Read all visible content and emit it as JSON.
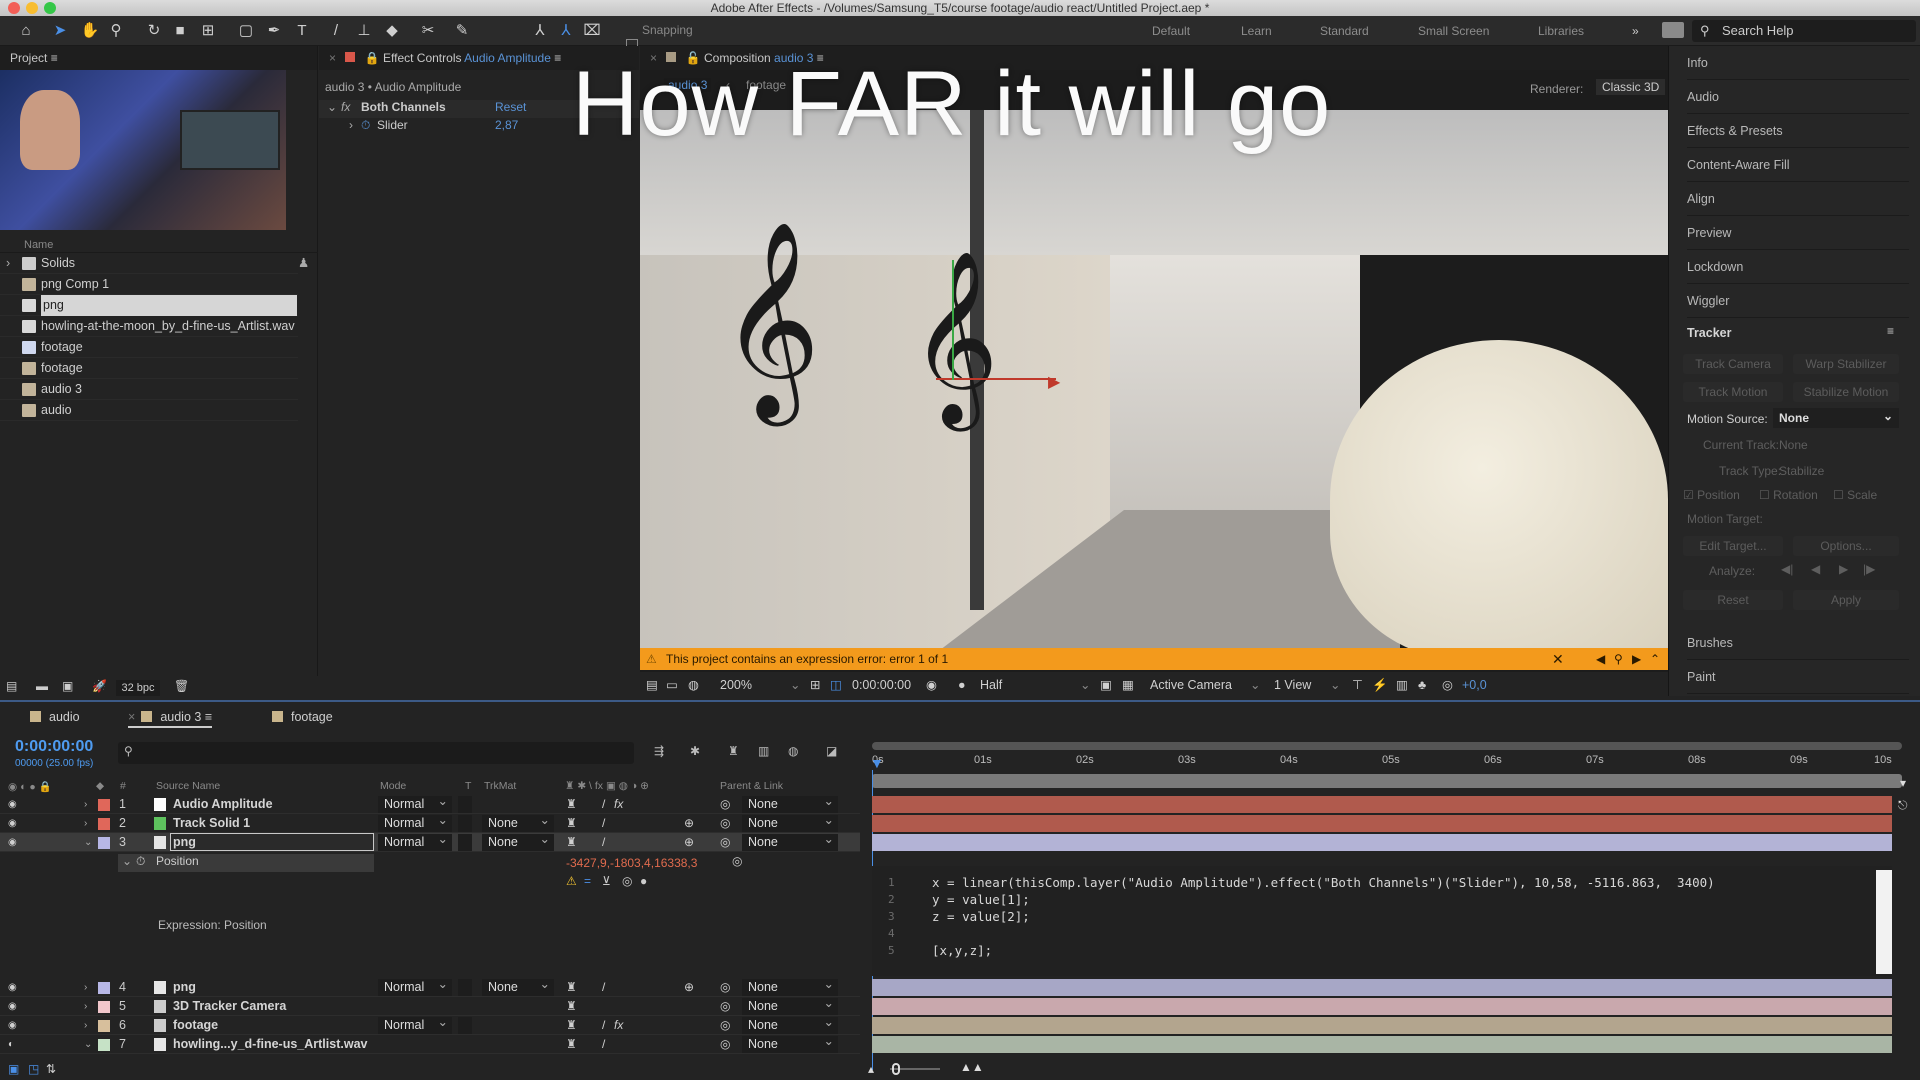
{
  "window": {
    "title": "Adobe After Effects - /Volumes/Samsung_T5/course footage/audio react/Untitled Project.aep *"
  },
  "toolbar": {
    "tools": [
      "home-icon",
      "selection-tool-icon",
      "hand-tool-icon",
      "zoom-tool-icon",
      "rotate-tool-icon",
      "camera-tool-icon",
      "pan-behind-icon",
      "rectangle-tool-icon",
      "pen-tool-icon",
      "type-tool-icon",
      "brush-tool-icon",
      "clone-stamp-icon",
      "eraser-icon",
      "roto-brush-icon",
      "puppet-pin-icon",
      "axis-local-icon",
      "axis-world-icon",
      "axis-view-icon"
    ],
    "snapping_label": "Snapping",
    "workspaces": [
      "Default",
      "Learn",
      "Standard",
      "Small Screen",
      "Libraries"
    ],
    "more": "»",
    "search_placeholder": "Search Help"
  },
  "project": {
    "tab_label": "Project",
    "name_header": "Name",
    "items": [
      {
        "name": "Solids",
        "type": "folder"
      },
      {
        "name": "png Comp 1",
        "type": "comp"
      },
      {
        "name": "png",
        "type": "file",
        "selected": true
      },
      {
        "name": "howling-at-the-moon_by_d-fine-us_Artlist.wav",
        "type": "audio"
      },
      {
        "name": "footage",
        "type": "video"
      },
      {
        "name": "footage",
        "type": "comp"
      },
      {
        "name": "audio 3",
        "type": "comp"
      },
      {
        "name": "audio",
        "type": "comp"
      }
    ],
    "bpc": "32 bpc"
  },
  "effect_controls": {
    "tab_prefix": "Effect Controls",
    "tab_layer": "Audio Amplitude",
    "breadcrumb": "audio 3 • Audio Amplitude",
    "effect_name": "Both Channels",
    "reset_label": "Reset",
    "property": "Slider",
    "property_value": "2,87"
  },
  "composition": {
    "tab_prefix": "Composition",
    "tab_name": "audio 3",
    "flow": [
      "audio 3",
      "footage"
    ],
    "renderer_label": "Renderer:",
    "renderer_value": "Classic 3D",
    "overlay_title": "How FAR it will go",
    "error_message": "This project contains an expression error: error 1 of 1",
    "viewbar": {
      "zoom": "200%",
      "timecode": "0:00:00:00",
      "resolution": "Half",
      "camera": "Active Camera",
      "views": "1 View",
      "exposure": "+0,0"
    }
  },
  "right_panel": {
    "items": [
      "Info",
      "Audio",
      "Effects & Presets",
      "Content-Aware Fill",
      "Align",
      "Preview",
      "Lockdown",
      "Wiggler"
    ],
    "tracker": {
      "title": "Tracker",
      "buttons": [
        "Track Camera",
        "Warp Stabilizer",
        "Track Motion",
        "Stabilize Motion"
      ],
      "motion_source_label": "Motion Source:",
      "motion_source_value": "None",
      "current_track_label": "Current Track:",
      "current_track_value": "None",
      "track_type_label": "Track Type:",
      "track_type_value": "Stabilize",
      "checks": [
        {
          "label": "Position",
          "checked": true
        },
        {
          "label": "Rotation",
          "checked": false
        },
        {
          "label": "Scale",
          "checked": false
        }
      ],
      "motion_target_label": "Motion Target:",
      "edit_target": "Edit Target...",
      "options": "Options...",
      "analyze_label": "Analyze:",
      "reset": "Reset",
      "apply": "Apply"
    },
    "bottom_items": [
      "Brushes",
      "Paint"
    ]
  },
  "timeline": {
    "tabs": [
      {
        "label": "audio",
        "color": "#c9b58c"
      },
      {
        "label": "audio 3",
        "color": "#c9b58c",
        "active": true
      },
      {
        "label": "footage",
        "color": "#c9b58c"
      }
    ],
    "timecode": "0:00:00:00",
    "fps": "00000 (25.00 fps)",
    "columns": {
      "num": "#",
      "source": "Source Name",
      "mode": "Mode",
      "t": "T",
      "trkmat": "TrkMat",
      "parent": "Parent & Link"
    },
    "layers": [
      {
        "num": "1",
        "name": "Audio Amplitude",
        "label_color": "#e0675a",
        "icon_color": "#ffffff",
        "mode": "Normal",
        "trkmat": "",
        "parent": "None",
        "fx": true,
        "bar": "#b05a4d"
      },
      {
        "num": "2",
        "name": "Track Solid 1",
        "label_color": "#e0675a",
        "icon_color": "#5ec25e",
        "mode": "Normal",
        "trkmat": "None",
        "parent": "None",
        "fx": false,
        "bar": "#b05a4d"
      },
      {
        "num": "3",
        "name": "png",
        "label_color": "#b7b7e6",
        "icon_color": "#e6e6e6",
        "mode": "Normal",
        "trkmat": "None",
        "parent": "None",
        "fx": false,
        "bar": "#b3b3d6",
        "selected": true
      },
      {
        "num": "4",
        "name": "png",
        "label_color": "#b7b7e6",
        "icon_color": "#e6e6e6",
        "mode": "Normal",
        "trkmat": "None",
        "parent": "None",
        "fx": false,
        "bar": "#a7a7c6"
      },
      {
        "num": "5",
        "name": "3D Tracker Camera",
        "label_color": "#f1c6cb",
        "icon_color": "#cccccc",
        "mode": "",
        "trkmat": "",
        "parent": "None",
        "fx": false,
        "bar": "#c9a8ad"
      },
      {
        "num": "6",
        "name": "footage",
        "label_color": "#d7bf9c",
        "icon_color": "#cccccc",
        "mode": "Normal",
        "trkmat": "",
        "parent": "None",
        "fx": true,
        "bar": "#b3a58e"
      },
      {
        "num": "7",
        "name": "howling...y_d-fine-us_Artlist.wav",
        "label_color": "#c6e2c6",
        "icon_color": "#e6e6e6",
        "mode": "",
        "trkmat": "",
        "parent": "None",
        "fx": false,
        "bar": "#a9b5a5"
      }
    ],
    "property": {
      "name": "Position",
      "value": "-3427,9,-1803,4,16338,3",
      "expression_label": "Expression: Position"
    },
    "ruler_ticks": [
      "0s",
      "01s",
      "02s",
      "03s",
      "04s",
      "05s",
      "06s",
      "07s",
      "08s",
      "09s",
      "10s"
    ],
    "expression_lines": [
      "x = linear(thisComp.layer(\"Audio Amplitude\").effect(\"Both Channels\")(\"Slider\"), 10,58, -5116.863,  3400)",
      "y = value[1];",
      "z = value[2];",
      "",
      "[x,y,z];"
    ]
  }
}
